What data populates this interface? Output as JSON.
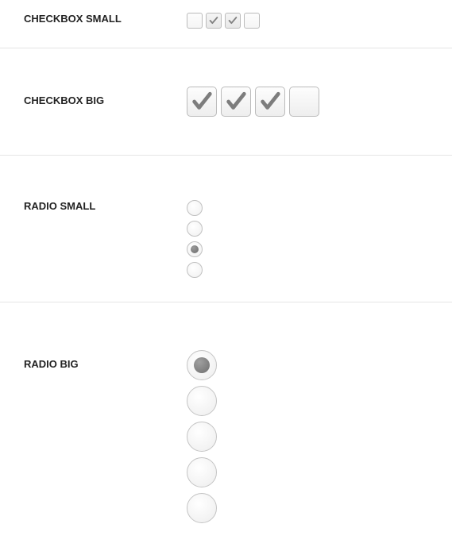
{
  "sections": {
    "checkbox_small": {
      "label": "CHECKBOX SMALL",
      "items": [
        {
          "checked": false
        },
        {
          "checked": true
        },
        {
          "checked": true
        },
        {
          "checked": false
        }
      ]
    },
    "checkbox_big": {
      "label": "CHECKBOX BIG",
      "items": [
        {
          "checked": true
        },
        {
          "checked": true
        },
        {
          "checked": true
        },
        {
          "checked": false
        }
      ]
    },
    "radio_small": {
      "label": "RADIO SMALL",
      "items": [
        {
          "checked": false
        },
        {
          "checked": false
        },
        {
          "checked": true
        },
        {
          "checked": false
        }
      ]
    },
    "radio_big": {
      "label": "RADIO BIG",
      "items": [
        {
          "checked": true
        },
        {
          "checked": false
        },
        {
          "checked": false
        },
        {
          "checked": false
        },
        {
          "checked": false
        }
      ]
    }
  }
}
